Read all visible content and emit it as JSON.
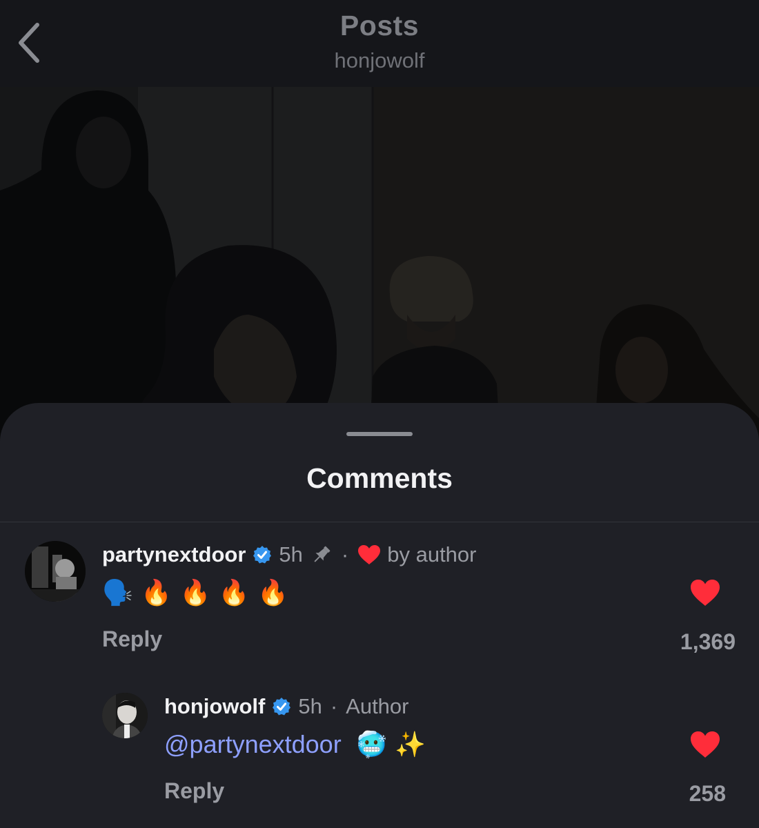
{
  "header": {
    "title": "Posts",
    "subtitle": "honjowolf",
    "back_icon": "chevron-left-icon"
  },
  "sheet": {
    "title": "Comments"
  },
  "comments": [
    {
      "username": "partynextdoor",
      "verified": true,
      "time": "5h",
      "pinned": true,
      "separator": "·",
      "liked_by_author_label": "by author",
      "text": "🗣️ 🔥 🔥 🔥 🔥",
      "reply_label": "Reply",
      "likes": "1,369",
      "liked": true
    },
    {
      "username": "honjowolf",
      "verified": true,
      "time": "5h",
      "separator": "·",
      "role_label": "Author",
      "mention": "@partynextdoor",
      "text_suffix": "🥶 ✨",
      "reply_label": "Reply",
      "likes": "258",
      "liked": true
    }
  ],
  "colors": {
    "accent_heart": "#ff2d3a",
    "verified_blue": "#3797f0",
    "mention": "#8ea0ff",
    "sheet_bg": "#1f2026"
  }
}
